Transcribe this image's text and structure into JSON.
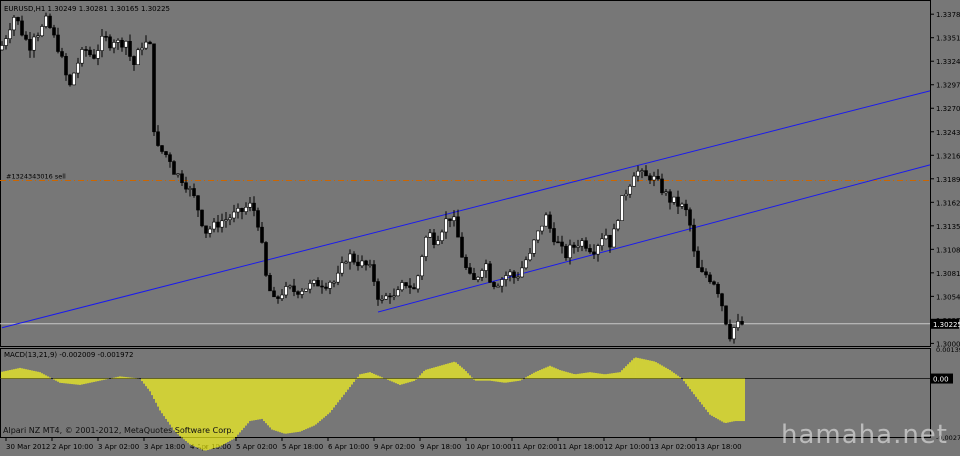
{
  "main_header": "EURUSD,H1  1.30249 1.30281 1.30165 1.30225",
  "macd_header": "MACD(13,21,9) -0.002009 -0.001972",
  "copyright": "Alpari NZ MT4, © 2001-2012, MetaQuotes Software Corp.",
  "watermark": "hamaha.net",
  "order_label": "#1324343016 sell",
  "current_price_label": "1.30225",
  "macd_zero_label": "0.00",
  "colors": {
    "background": "#777777",
    "candle": "#000000",
    "channel": "#1a1aee",
    "order_line": "#cc6600",
    "bid_line": "#c8c8c8",
    "macd": "#f5f51e",
    "axis_text": "#000000"
  },
  "chart_data": [
    {
      "type": "candlestick",
      "symbol": "EURUSD",
      "timeframe": "H1",
      "title": "EURUSD,H1  1.30249 1.30281 1.30165 1.30225",
      "ylim": [
        1.2997,
        1.3392
      ],
      "y_ticks": [
        "1.33780",
        "1.33510",
        "1.33240",
        "1.32970",
        "1.32700",
        "1.32430",
        "1.32160",
        "1.31890",
        "1.31620",
        "1.31350",
        "1.31080",
        "1.30810",
        "1.30540",
        "1.30270",
        "1.30000"
      ],
      "x_ticks": [
        "30 Mar 2012",
        "2 Apr 10:00",
        "3 Apr 02:00",
        "3 Apr 18:00",
        "4 Apr 10:00",
        "5 Apr 02:00",
        "5 Apr 18:00",
        "6 Apr 10:00",
        "9 Apr 02:00",
        "9 Apr 18:00",
        "10 Apr 10:00",
        "11 Apr 02:00",
        "11 Apr 18:00",
        "12 Apr 10:00",
        "13 Apr 02:00",
        "13 Apr 18:00"
      ],
      "price_path": [
        [
          0,
          1.3337
        ],
        [
          5,
          1.335
        ],
        [
          10,
          1.3365
        ],
        [
          15,
          1.3378
        ],
        [
          20,
          1.3362
        ],
        [
          25,
          1.335
        ],
        [
          30,
          1.3342
        ],
        [
          35,
          1.336
        ],
        [
          40,
          1.3355
        ],
        [
          45,
          1.3372
        ],
        [
          50,
          1.3362
        ],
        [
          55,
          1.3348
        ],
        [
          60,
          1.3335
        ],
        [
          65,
          1.331
        ],
        [
          70,
          1.3295
        ],
        [
          75,
          1.3315
        ],
        [
          80,
          1.3328
        ],
        [
          85,
          1.3338
        ],
        [
          90,
          1.3332
        ],
        [
          95,
          1.333
        ],
        [
          100,
          1.3345
        ],
        [
          105,
          1.335
        ],
        [
          110,
          1.3345
        ],
        [
          115,
          1.335
        ],
        [
          120,
          1.3342
        ],
        [
          125,
          1.3352
        ],
        [
          130,
          1.333
        ],
        [
          135,
          1.3318
        ],
        [
          140,
          1.3342
        ],
        [
          145,
          1.3345
        ],
        [
          150,
          1.334
        ],
        [
          155,
          1.3225
        ],
        [
          160,
          1.3222
        ],
        [
          165,
          1.3218
        ],
        [
          170,
          1.3212
        ],
        [
          175,
          1.3195
        ],
        [
          180,
          1.3192
        ],
        [
          185,
          1.3185
        ],
        [
          190,
          1.3175
        ],
        [
          195,
          1.3165
        ],
        [
          200,
          1.3148
        ],
        [
          205,
          1.3128
        ],
        [
          210,
          1.3132
        ],
        [
          215,
          1.3135
        ],
        [
          220,
          1.314
        ],
        [
          225,
          1.3142
        ],
        [
          230,
          1.3145
        ],
        [
          235,
          1.3148
        ],
        [
          240,
          1.315
        ],
        [
          245,
          1.3155
        ],
        [
          250,
          1.3158
        ],
        [
          255,
          1.3152
        ],
        [
          260,
          1.313
        ],
        [
          265,
          1.308
        ],
        [
          270,
          1.306
        ],
        [
          275,
          1.3045
        ],
        [
          280,
          1.3058
        ],
        [
          285,
          1.306
        ],
        [
          290,
          1.3062
        ],
        [
          295,
          1.306
        ],
        [
          300,
          1.3062
        ],
        [
          305,
          1.3064
        ],
        [
          310,
          1.3066
        ],
        [
          315,
          1.3068
        ],
        [
          320,
          1.307
        ],
        [
          325,
          1.3068
        ],
        [
          330,
          1.3072
        ],
        [
          335,
          1.307
        ],
        [
          340,
          1.308
        ],
        [
          345,
          1.3098
        ],
        [
          350,
          1.31
        ],
        [
          355,
          1.3095
        ],
        [
          360,
          1.3092
        ],
        [
          365,
          1.309
        ],
        [
          370,
          1.3085
        ],
        [
          375,
          1.307
        ],
        [
          380,
          1.3045
        ],
        [
          385,
          1.3052
        ],
        [
          390,
          1.3058
        ],
        [
          395,
          1.305
        ],
        [
          400,
          1.3062
        ],
        [
          405,
          1.307
        ],
        [
          410,
          1.3066
        ],
        [
          415,
          1.306
        ],
        [
          420,
          1.309
        ],
        [
          425,
          1.312
        ],
        [
          430,
          1.3125
        ],
        [
          435,
          1.3118
        ],
        [
          440,
          1.3128
        ],
        [
          445,
          1.314
        ],
        [
          450,
          1.3145
        ],
        [
          455,
          1.3138
        ],
        [
          460,
          1.311
        ],
        [
          465,
          1.3088
        ],
        [
          470,
          1.3075
        ],
        [
          475,
          1.307
        ],
        [
          480,
          1.3085
        ],
        [
          485,
          1.3095
        ],
        [
          490,
          1.3075
        ],
        [
          495,
          1.3068
        ],
        [
          500,
          1.3072
        ],
        [
          505,
          1.3078
        ],
        [
          510,
          1.308
        ],
        [
          515,
          1.3075
        ],
        [
          520,
          1.3082
        ],
        [
          525,
          1.3095
        ],
        [
          530,
          1.31
        ],
        [
          535,
          1.312
        ],
        [
          540,
          1.313
        ],
        [
          545,
          1.3148
        ],
        [
          550,
          1.3132
        ],
        [
          555,
          1.312
        ],
        [
          560,
          1.311
        ],
        [
          565,
          1.31
        ],
        [
          570,
          1.3108
        ],
        [
          575,
          1.3112
        ],
        [
          580,
          1.3118
        ],
        [
          585,
          1.3115
        ],
        [
          590,
          1.311
        ],
        [
          595,
          1.3108
        ],
        [
          600,
          1.312
        ],
        [
          605,
          1.3128
        ],
        [
          610,
          1.3115
        ],
        [
          615,
          1.313
        ],
        [
          620,
          1.3158
        ],
        [
          625,
          1.3172
        ],
        [
          630,
          1.3185
        ],
        [
          635,
          1.32
        ],
        [
          640,
          1.3195
        ],
        [
          645,
          1.319
        ],
        [
          650,
          1.3192
        ],
        [
          655,
          1.3188
        ],
        [
          660,
          1.318
        ],
        [
          665,
          1.3172
        ],
        [
          670,
          1.3165
        ],
        [
          675,
          1.3162
        ],
        [
          680,
          1.3158
        ],
        [
          685,
          1.3155
        ],
        [
          690,
          1.3135
        ],
        [
          695,
          1.3095
        ],
        [
          700,
          1.3078
        ],
        [
          705,
          1.308
        ],
        [
          710,
          1.3075
        ],
        [
          715,
          1.307
        ],
        [
          720,
          1.3055
        ],
        [
          725,
          1.303
        ],
        [
          730,
          1.301
        ],
        [
          735,
          1.302
        ],
        [
          740,
          1.3022
        ]
      ]
    },
    {
      "type": "histogram",
      "title": "MACD(13,21,9) -0.002009 -0.001972",
      "ylim": [
        -0.00275,
        0.00139
      ],
      "y_ticks": [
        "0.00139",
        "0.00",
        "-0.00275"
      ],
      "macd_path": [
        [
          0,
          0.0003
        ],
        [
          20,
          0.0005
        ],
        [
          40,
          0.0003
        ],
        [
          60,
          -0.0002
        ],
        [
          80,
          -0.0003
        ],
        [
          100,
          -0.0001
        ],
        [
          120,
          0.0001
        ],
        [
          140,
          0.0
        ],
        [
          150,
          -0.0006
        ],
        [
          160,
          -0.0015
        ],
        [
          175,
          -0.0025
        ],
        [
          190,
          -0.0031
        ],
        [
          205,
          -0.0034
        ],
        [
          220,
          -0.0032
        ],
        [
          235,
          -0.0028
        ],
        [
          250,
          -0.002
        ],
        [
          262,
          -0.0019
        ],
        [
          272,
          -0.0024
        ],
        [
          285,
          -0.0026
        ],
        [
          300,
          -0.0025
        ],
        [
          315,
          -0.0022
        ],
        [
          330,
          -0.0016
        ],
        [
          345,
          -0.0007
        ],
        [
          360,
          0.0002
        ],
        [
          370,
          0.0003
        ],
        [
          385,
          0.0
        ],
        [
          400,
          -0.0003
        ],
        [
          415,
          -0.0001
        ],
        [
          425,
          0.0004
        ],
        [
          440,
          0.0006
        ],
        [
          455,
          0.0008
        ],
        [
          465,
          0.0004
        ],
        [
          475,
          -0.0001
        ],
        [
          490,
          -0.0001
        ],
        [
          505,
          -0.0002
        ],
        [
          520,
          -0.0001
        ],
        [
          535,
          0.0003
        ],
        [
          550,
          0.0006
        ],
        [
          560,
          0.0004
        ],
        [
          575,
          0.0002
        ],
        [
          590,
          0.0003
        ],
        [
          605,
          0.0002
        ],
        [
          620,
          0.0003
        ],
        [
          635,
          0.001
        ],
        [
          645,
          0.0009
        ],
        [
          655,
          0.0008
        ],
        [
          670,
          0.0004
        ],
        [
          682,
          0.0
        ],
        [
          695,
          -0.0008
        ],
        [
          710,
          -0.0017
        ],
        [
          725,
          -0.0021
        ],
        [
          735,
          -0.002
        ],
        [
          744,
          -0.002
        ]
      ]
    }
  ]
}
